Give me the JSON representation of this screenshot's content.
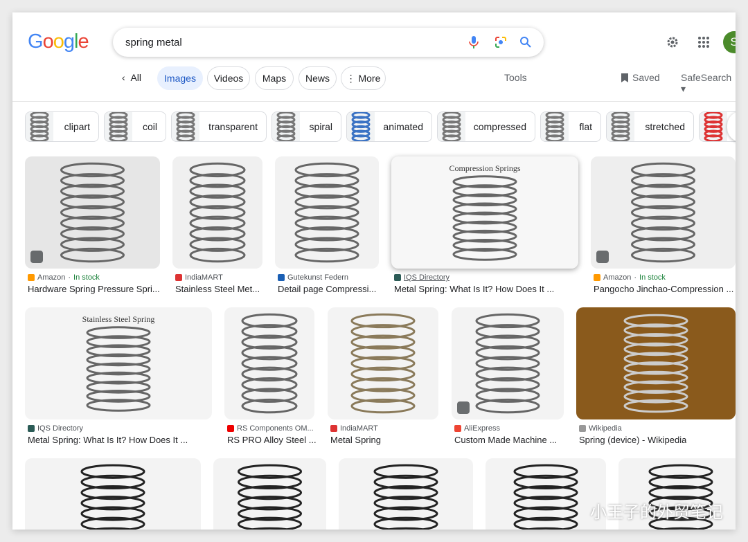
{
  "header": {
    "logo": "Google",
    "query": "spring metal",
    "avatar_initial": "S"
  },
  "tabs": {
    "back": "All",
    "items": [
      "Images",
      "Videos",
      "Maps",
      "News",
      "More"
    ],
    "active": "Images",
    "tools": "Tools",
    "saved": "Saved",
    "safesearch": "SafeSearch"
  },
  "chips": [
    "clipart",
    "coil",
    "transparent",
    "spiral",
    "animated",
    "compressed",
    "flat",
    "stretched"
  ],
  "results": [
    {
      "source": "Amazon",
      "stock": "In stock",
      "title": "Hardware Spring Pressure Spri...",
      "color": "#e6e6e6"
    },
    {
      "source": "IndiaMART",
      "title": "Stainless Steel Met...",
      "color": "#f0f0f0"
    },
    {
      "source": "Gutekunst Federn",
      "title": "Detail page Compressi...",
      "color": "#f2f2f2"
    },
    {
      "source": "IQS Directory",
      "title": "Metal Spring: What Is It? How Does It ...",
      "image_text": "Compression Springs",
      "color": "#f7f7f7"
    },
    {
      "source": "Amazon",
      "stock": "In stock",
      "title": "Pangocho Jinchao-Compression ...",
      "color": "#eeeeee"
    },
    {
      "source": "IQS Directory",
      "title": "Metal Spring: What Is It? How Does It ...",
      "image_text": "Stainless Steel Spring",
      "color": "#f4f4f4"
    },
    {
      "source": "RS Components OM...",
      "title": "RS PRO Alloy Steel ...",
      "color": "#f3f3f3"
    },
    {
      "source": "IndiaMART",
      "title": "Metal Spring",
      "color": "#f3f3f3"
    },
    {
      "source": "AliExpress",
      "title": "Custom Made Machine ...",
      "color": "#f3f3f3"
    },
    {
      "source": "Wikipedia",
      "title": "Spring (device) - Wikipedia",
      "color": "#8a5a1c"
    }
  ],
  "watermark": "小王子的外贸笔记"
}
